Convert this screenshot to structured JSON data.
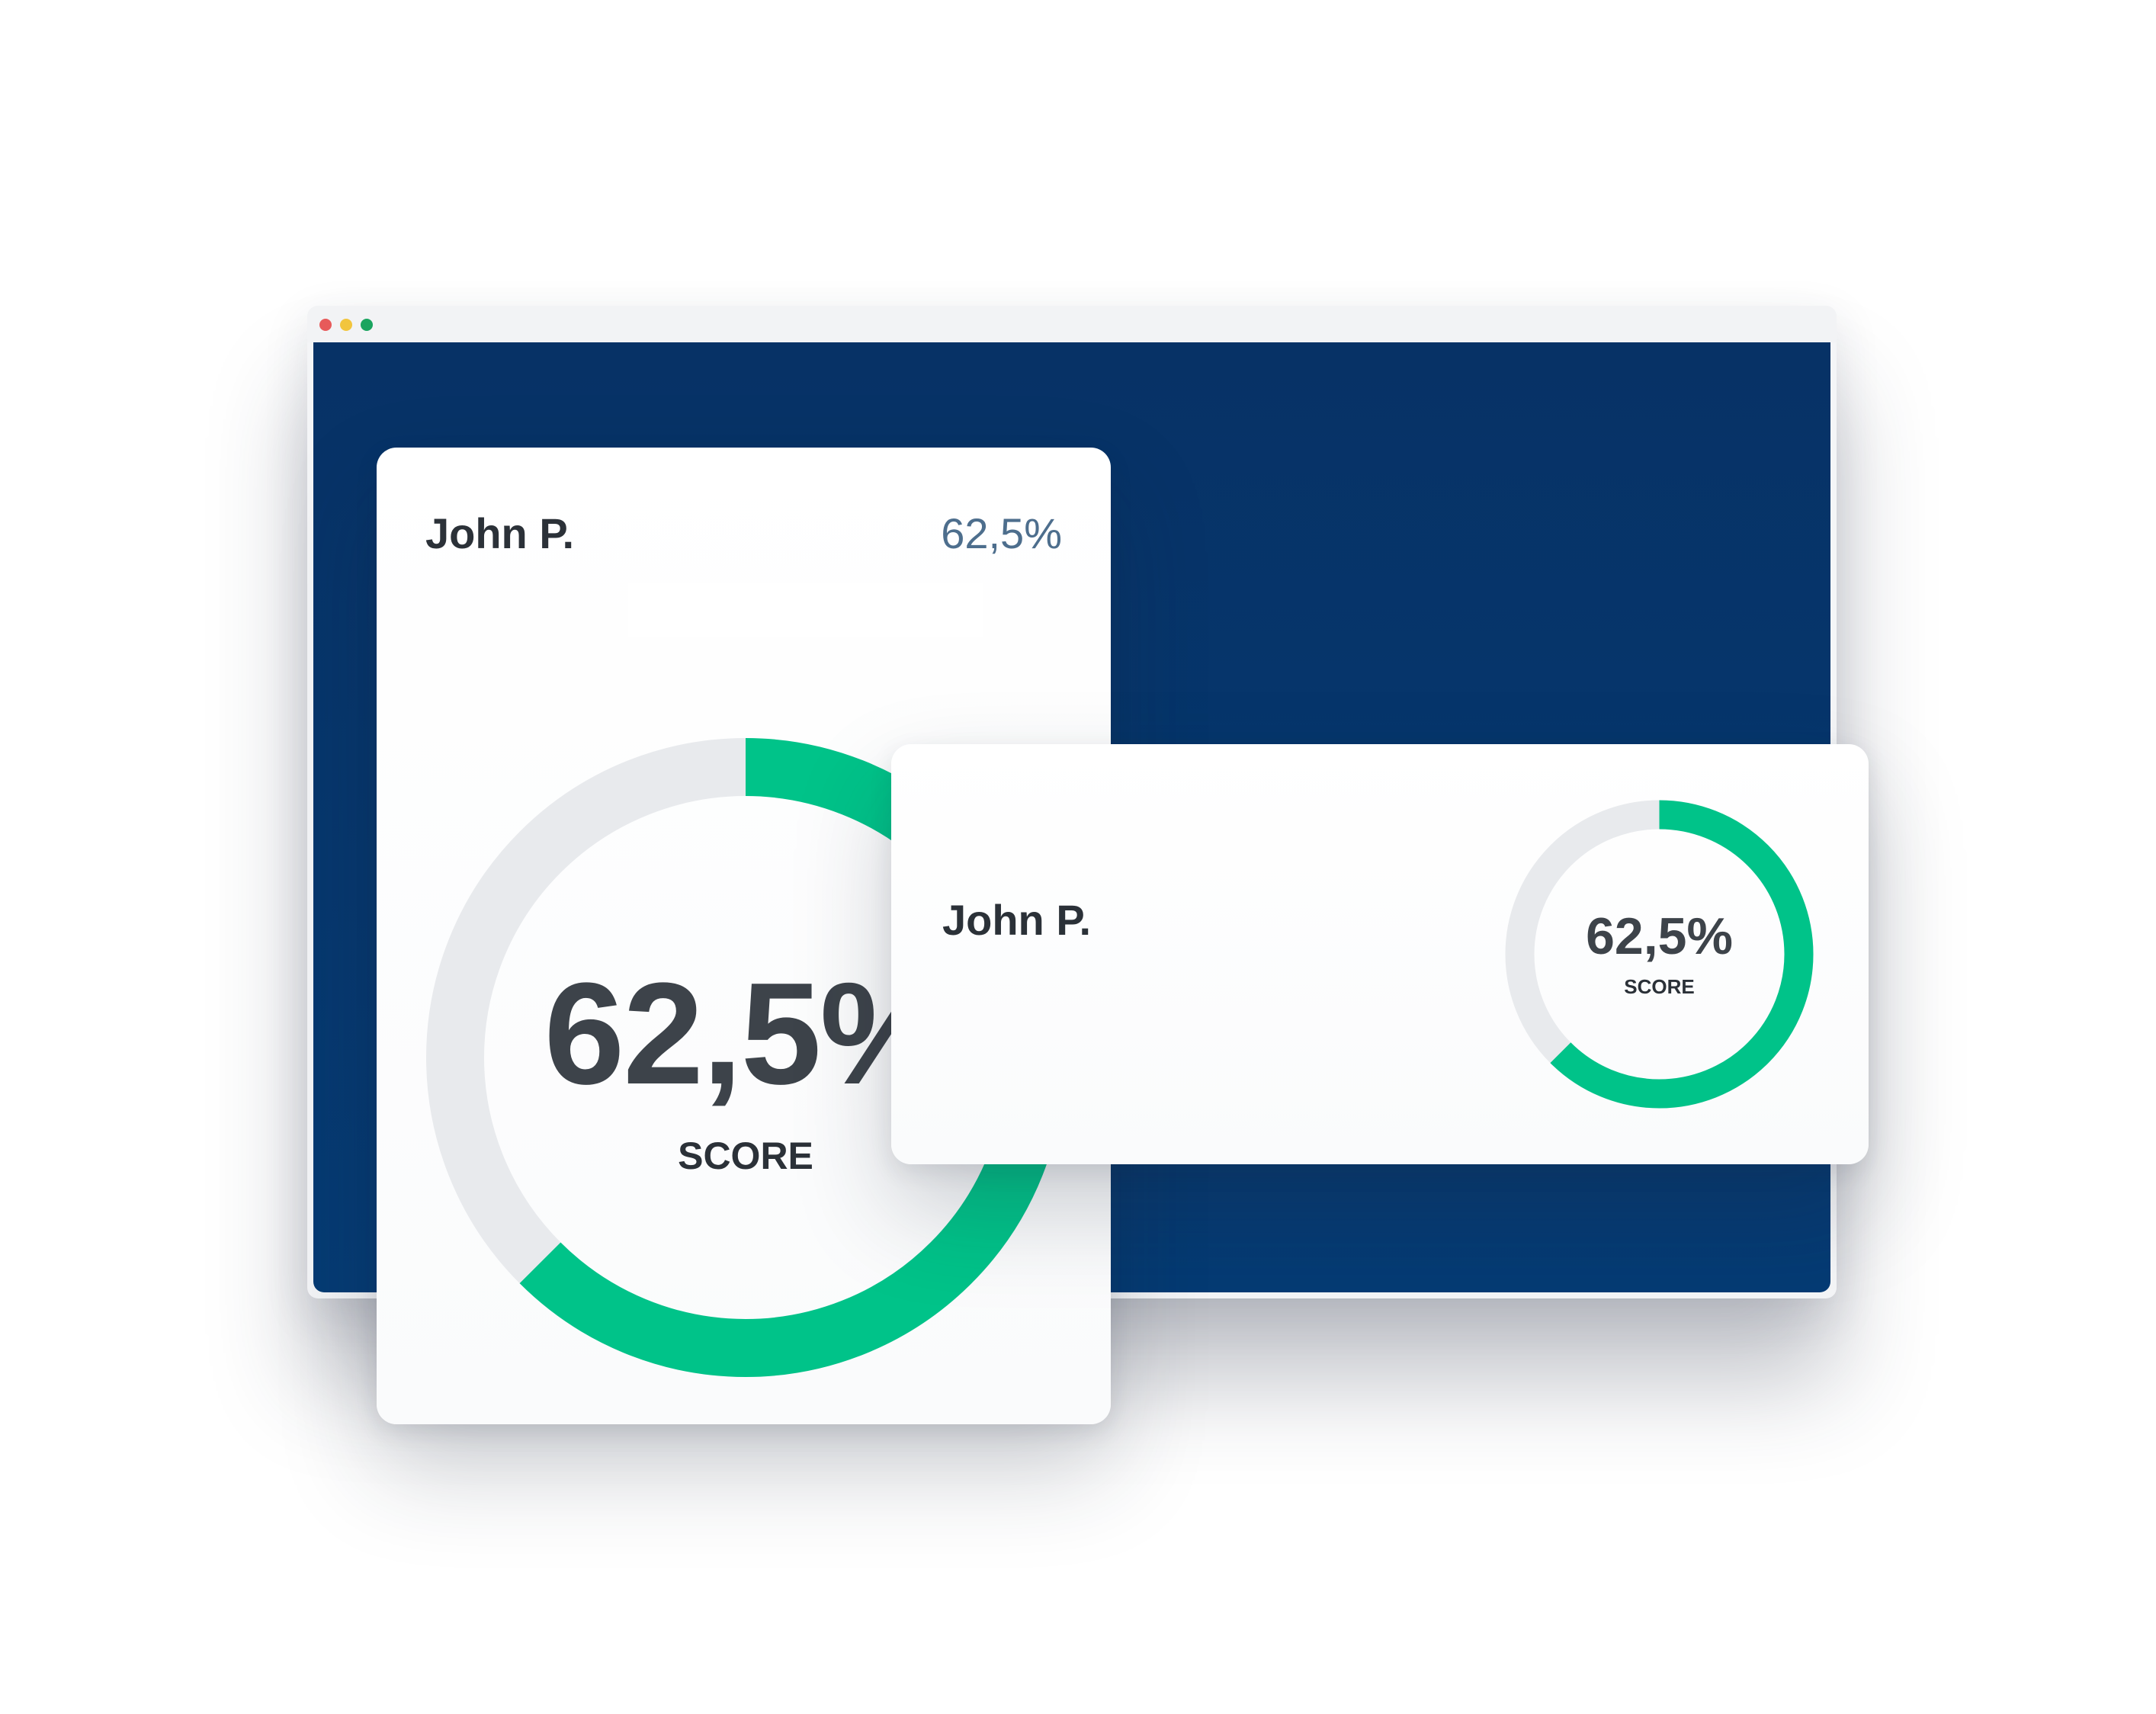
{
  "browser": {
    "dots": [
      {
        "name": "close",
        "color": "#e75a5a"
      },
      {
        "name": "minimize",
        "color": "#f2c53d"
      },
      {
        "name": "maximize",
        "color": "#1aa45f"
      }
    ],
    "content_color_top": "#073266",
    "content_color_bottom": "#053b74"
  },
  "colors": {
    "accent_green": "#00c389",
    "track_gray": "#e8eaed"
  },
  "large_card": {
    "name": "John P.",
    "header_score": "62,5%",
    "ring_value": "62,5%",
    "ring_label": "SCORE",
    "progress": 0.625
  },
  "small_card": {
    "name": "John P.",
    "ring_value": "62,5%",
    "ring_label": "SCORE",
    "progress": 0.625
  }
}
